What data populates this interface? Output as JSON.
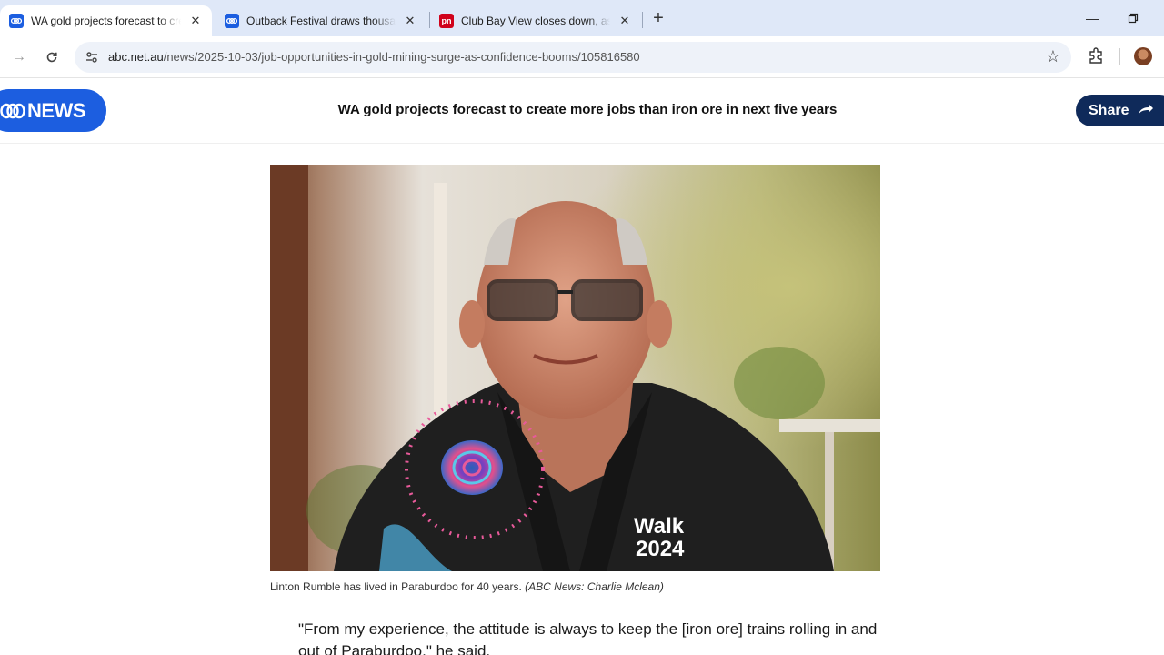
{
  "browser": {
    "tabs": [
      {
        "title": "WA gold projects forecast to create more jobs than iron ore",
        "favicon": "abc-icon",
        "favicon_color": "#1c5ee0",
        "active": true
      },
      {
        "title": "Outback Festival draws thousands",
        "favicon": "abc-icon",
        "favicon_color": "#1c5ee0",
        "active": false
      },
      {
        "title": "Club Bay View closes down, as",
        "favicon": "pn-icon",
        "favicon_color": "#d0021b",
        "active": false
      }
    ],
    "address_bar": {
      "domain": "abc.net.au",
      "path": "/news/2025-10-03/job-opportunities-in-gold-mining-surge-as-confidence-booms/105816580"
    }
  },
  "site": {
    "logo_text": "NEWS",
    "brand_color": "#1c5ee0",
    "headline": "WA gold projects forecast to create more jobs than iron ore in next five years",
    "share_label": "Share",
    "share_color": "#0f2a5a"
  },
  "article": {
    "caption": "Linton Rumble has lived in Paraburdoo for 40 years.",
    "credit": "(ABC News: Charlie Mclean)",
    "shirt_text_line1": "Walk",
    "shirt_text_line2": "2024",
    "quote": "\"From my experience, the attitude is always to keep the [iron ore] trains rolling in and out of Paraburdoo,\" he said."
  }
}
